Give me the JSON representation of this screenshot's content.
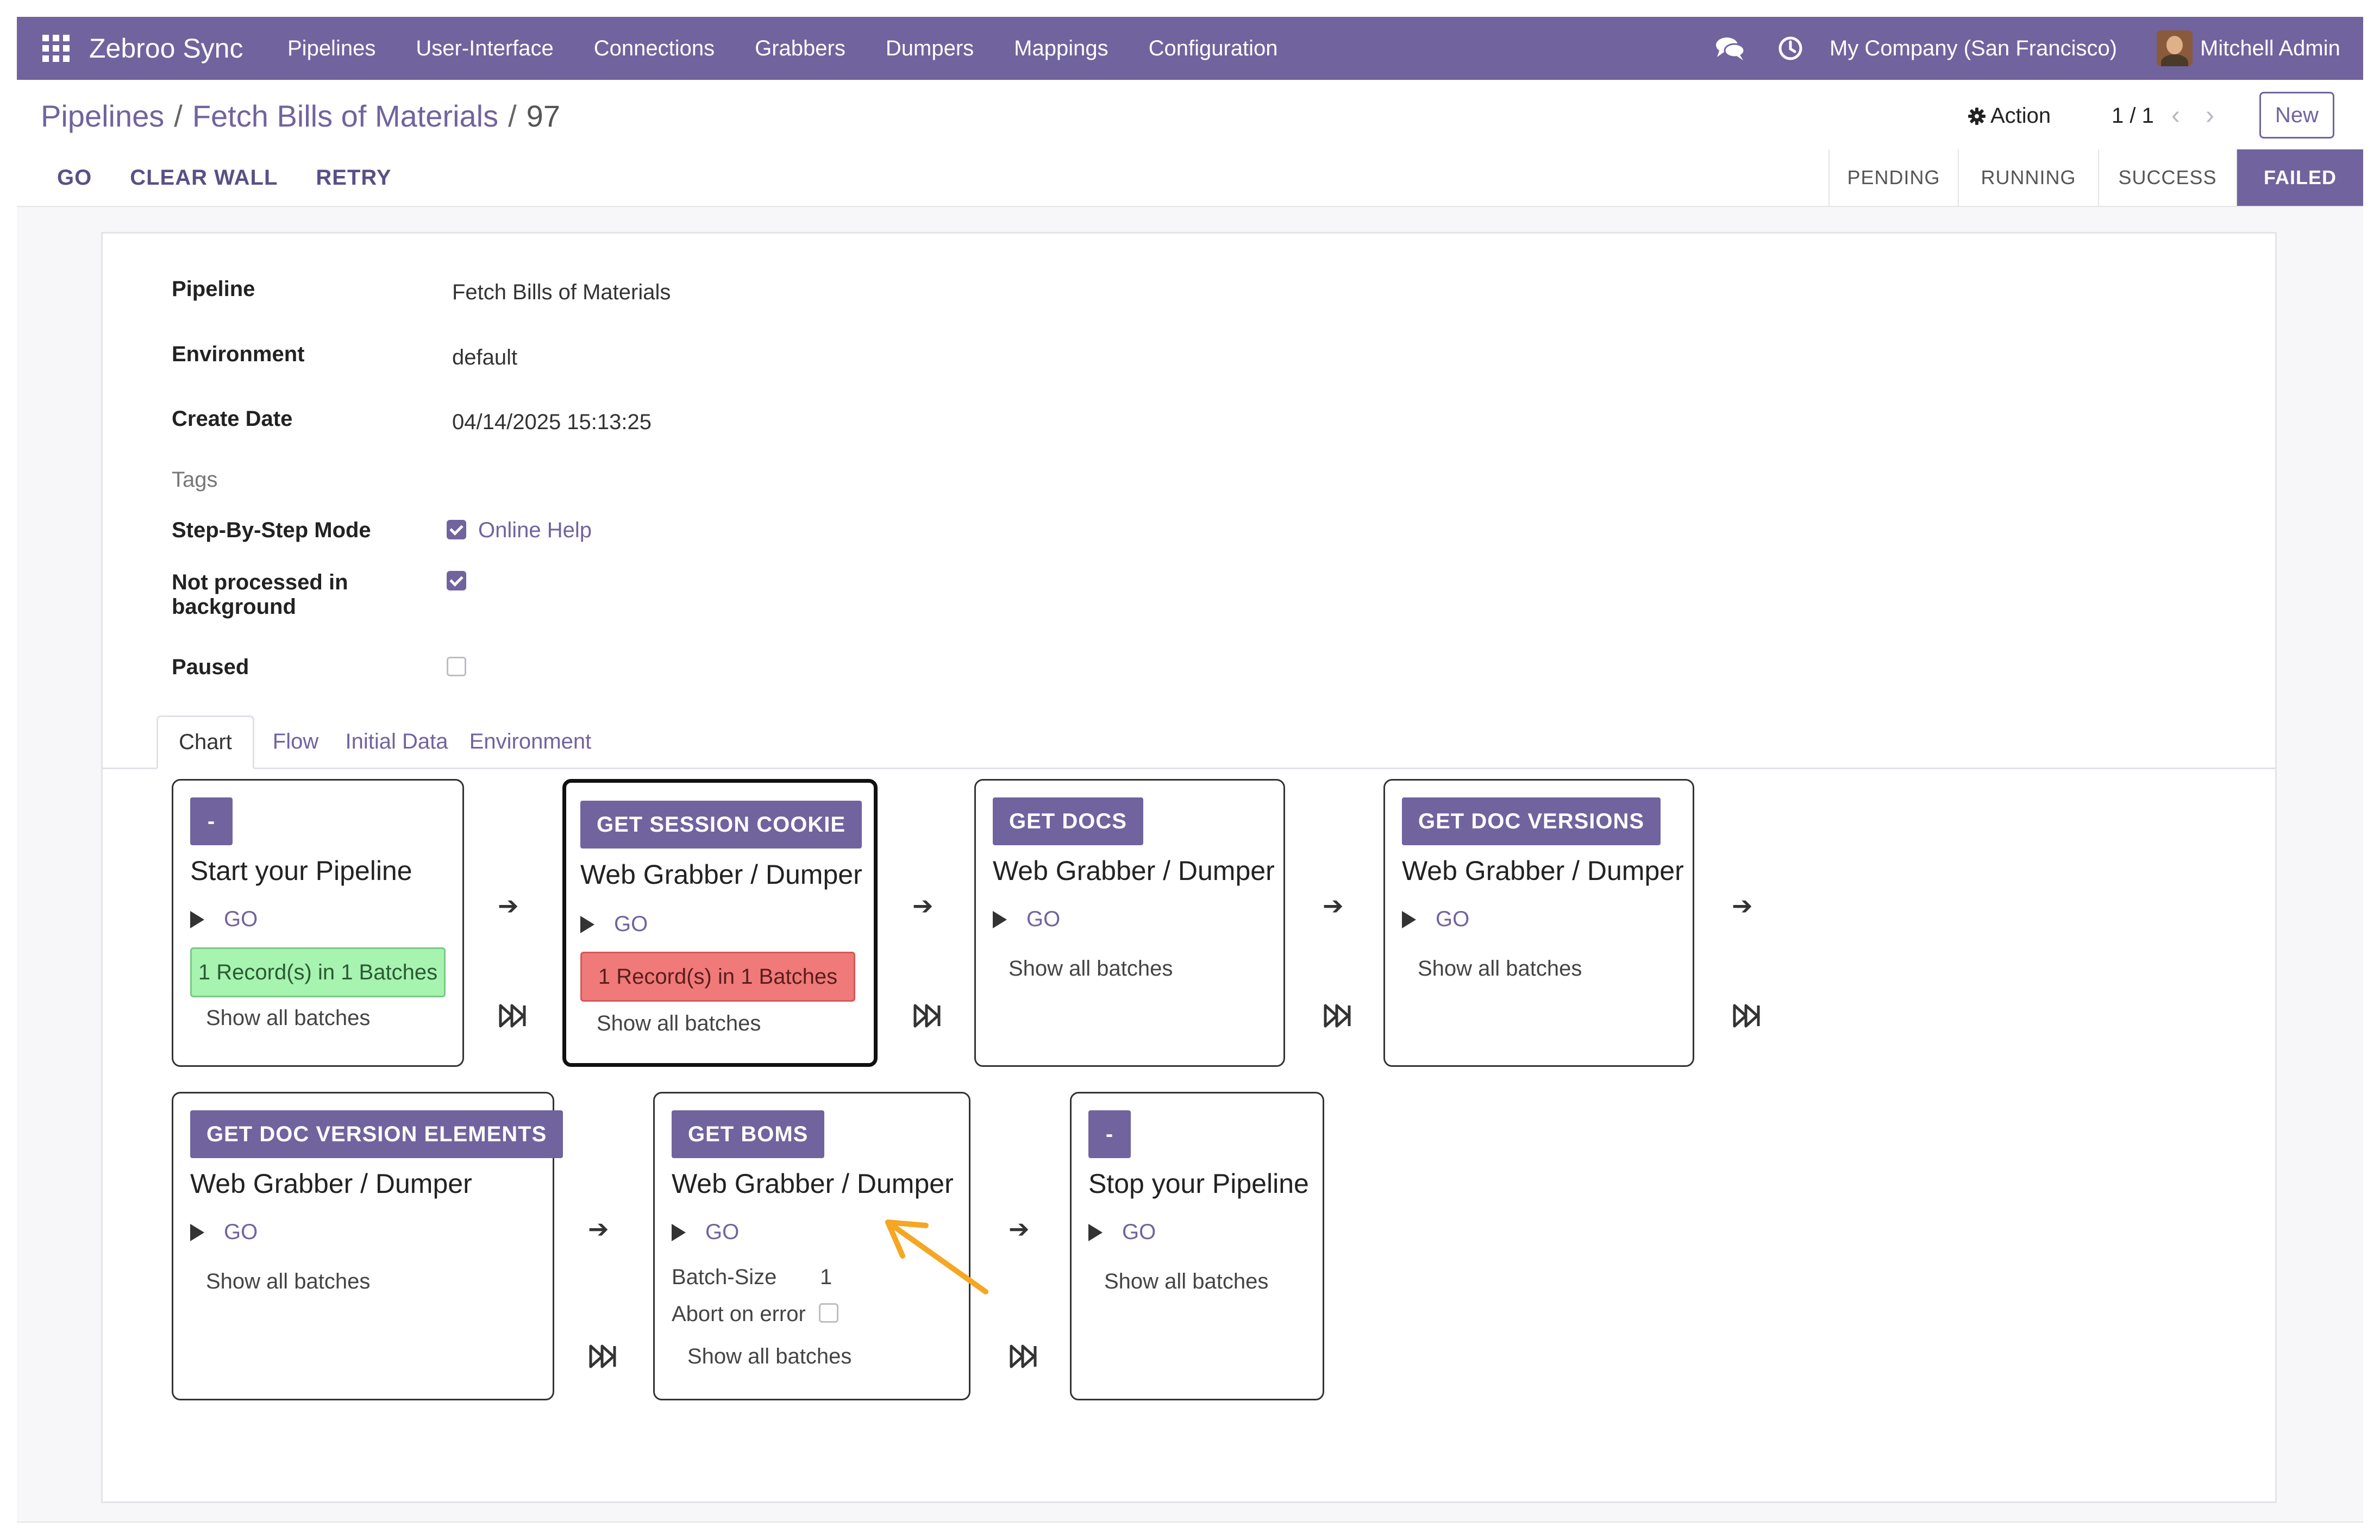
{
  "navbar": {
    "app_name": "Zebroo Sync",
    "menu": [
      "Pipelines",
      "User-Interface",
      "Connections",
      "Grabbers",
      "Dumpers",
      "Mappings",
      "Configuration"
    ],
    "company": "My Company (San Francisco)",
    "user": "Mitchell Admin"
  },
  "breadcrumb": {
    "root": "Pipelines",
    "sep": "/",
    "middle": "Fetch Bills of Materials",
    "current": "97"
  },
  "control": {
    "action_label": "Action",
    "pager": "1 / 1",
    "prev": "‹",
    "next": "›",
    "new_label": "New"
  },
  "statusbar": {
    "buttons": [
      "GO",
      "CLEAR WALL",
      "RETRY"
    ],
    "stages": [
      "PENDING",
      "RUNNING",
      "SUCCESS",
      "FAILED"
    ],
    "active_stage": "FAILED"
  },
  "form": {
    "pipeline_label": "Pipeline",
    "pipeline_value": "Fetch Bills of Materials",
    "environment_label": "Environment",
    "environment_value": "default",
    "create_date_label": "Create Date",
    "create_date_value": "04/14/2025 15:13:25",
    "tags_label": "Tags",
    "step_mode_label": "Step-By-Step Mode",
    "step_mode_checked": true,
    "online_help": "Online Help",
    "not_processed_label_1": "Not processed in",
    "not_processed_label_2": "background",
    "not_processed_checked": true,
    "paused_label": "Paused",
    "paused_checked": false
  },
  "tabs": [
    "Chart",
    "Flow",
    "Initial Data",
    "Environment"
  ],
  "active_tab": "Chart",
  "cards": {
    "start": {
      "badge": "-",
      "title": "Start your Pipeline",
      "go": "GO",
      "records": "1 Record(s) in 1 Batches",
      "show": "Show all batches"
    },
    "session": {
      "badge": "GET SESSION COOKIE",
      "title": "Web Grabber / Dumper",
      "go": "GO",
      "records": "1 Record(s) in 1 Batches",
      "show": "Show all batches"
    },
    "docs": {
      "badge": "GET DOCS",
      "title": "Web Grabber / Dumper",
      "go": "GO",
      "show": "Show all batches"
    },
    "versions": {
      "badge": "GET DOC VERSIONS",
      "title": "Web Grabber / Dumper",
      "go": "GO",
      "show": "Show all batches"
    },
    "elements": {
      "badge": "GET DOC VERSION ELEMENTS",
      "title": "Web Grabber / Dumper",
      "go": "GO",
      "show": "Show all batches"
    },
    "boms": {
      "badge": "GET BOMS",
      "title": "Web Grabber / Dumper",
      "go": "GO",
      "batch_size_label": "Batch-Size",
      "batch_size_value": "1",
      "abort_label": "Abort on error",
      "abort_checked": false,
      "show": "Show all batches"
    },
    "stop": {
      "badge": "-",
      "title": "Stop your Pipeline",
      "go": "GO",
      "show": "Show all batches"
    }
  },
  "arrow_glyph": "➔",
  "colors": {
    "brand": "#71639e",
    "success_fill": "#a7f3b0",
    "error_fill": "#f07a79",
    "annotation": "#f5a623"
  }
}
